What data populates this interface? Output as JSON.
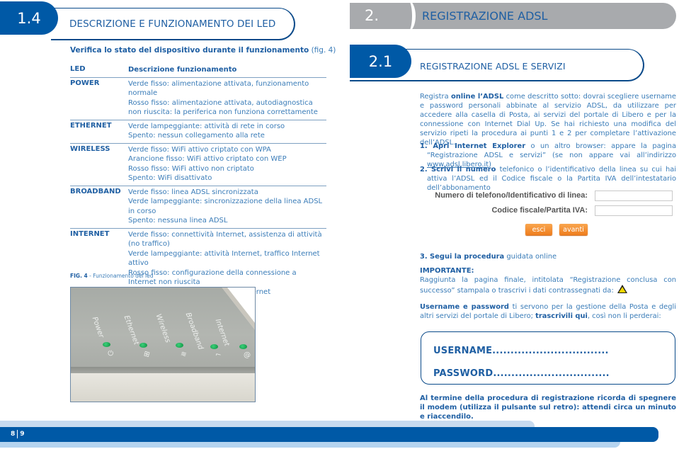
{
  "left_page": {
    "section_number": "1.4",
    "section_title": "DESCRIZIONE E FUNZIONAMENTO DEI LED",
    "subtitle_bold": "Verifica lo stato del dispositivo durante il funzionamento",
    "subtitle_ref": " (fig. 4)",
    "table": {
      "headers": [
        "LED",
        "Descrizione funzionamento"
      ],
      "rows": [
        {
          "led": "POWER",
          "lines": [
            "Verde fisso: alimentazione attivata, funzionamento normale",
            "Rosso fisso: alimentazione attivata, autodiagnostica non riuscita: la periferica non funziona correttamente"
          ]
        },
        {
          "led": "ETHERNET",
          "lines": [
            "Verde lampeggiante: attività di rete in corso",
            "Spento: nessun collegamento alla rete"
          ]
        },
        {
          "led": "WIRELESS",
          "lines": [
            "Verde fisso: WiFi attivo criptato con WPA",
            "Arancione fisso: WiFi attivo criptato con WEP",
            "Rosso fisso: WiFi attivo non criptato",
            "Spento: WiFi disattivato"
          ]
        },
        {
          "led": "BROADBAND",
          "lines": [
            "Verde fisso: linea ADSL sincronizzata",
            "Verde lampeggiante: sincronizzazione della linea ADSL in corso",
            "Spento: nessuna linea ADSL"
          ]
        },
        {
          "led": "INTERNET",
          "lines": [
            "Verde fisso: connettività Internet, assistenza di attività (no traffico)",
            "Verde lampeggiante: attività Internet, traffico Internet attivo",
            "Rosso fisso: configurazione della connessione a Internet non riuscita",
            "Spento: nessuna connessione a Internet"
          ]
        }
      ]
    },
    "figure": {
      "caption_label": "FIG. 4",
      "caption_text": " - Funzionamento dei led",
      "device_labels": [
        "Power",
        "Ethernet",
        "Wireless",
        "Broadband",
        "Internet"
      ],
      "device_symbols": [
        "⏻",
        "⊞",
        "≋",
        "⌐",
        "@"
      ]
    }
  },
  "right_page": {
    "chapter_number": "2.",
    "chapter_title": "REGISTRAZIONE ADSL",
    "section_number": "2.1",
    "section_title": "REGISTRAZIONE ADSL E SERVIZI",
    "intro": {
      "pre": "Registra ",
      "bold": "online l’ADSL",
      "post": " come descritto sotto: dovrai scegliere username e password personali abbinate al servizio ADSL, da utilizzare per accedere alla casella di Posta, ai servizi del portale di Libero e per la connessione con Internet Dial Up. Se hai richiesto una modifica del servizio ripeti la procedura ai punti 1 e 2 per completare l’attivazione dell’ADSL."
    },
    "step1": {
      "bold": "1. Apri Internet Explorer",
      "text": " o un altro browser: appare la pagina “Registrazione ADSL e servizi” (se non appare vai all’indirizzo ",
      "link": "www.adsl.libero.it",
      "end": ")"
    },
    "step2": {
      "bold": "2. Scrivi il numero",
      "text": " telefonico o l’identificativo della linea su cui hai attiva l’ADSL ed il Codice fiscale o la Partita IVA dell’intestatario dell’abbonamento"
    },
    "form": {
      "phone_label": "Numero di telefono/Identificativo di linea:",
      "phone_value": "",
      "cf_label": "Codice fiscale/Partita IVA:",
      "cf_value": "",
      "exit_button": "esci",
      "next_button": "avanti"
    },
    "step3": {
      "bold": "3. Segui la procedura",
      "text": " guidata online"
    },
    "important": {
      "title": "IMPORTANTE:",
      "text": "Raggiunta la pagina finale, intitolata “Registrazione conclusa con successo” stampala o trascrivi i dati contrassegnati da: ",
      "icon": "warning-icon"
    },
    "credentials_note": {
      "bold1": "Username e password",
      "text1": " ti servono per la gestione della Posta e degli altri servizi del portale di Libero; ",
      "bold2": "trascrivili qui",
      "text2": ", così non li perderai:"
    },
    "credentials": {
      "username_label": "USERNAME",
      "username_dots": "................................",
      "password_label": "PASSWORD",
      "password_dots": "................................"
    },
    "final_note": "Al termine della procedura di registrazione ricorda di spegnere il modem (utilizza il pulsante sul retro): attendi circa un minuto e riaccendilo."
  },
  "footer": {
    "page_left": "8",
    "page_right": "9"
  }
}
